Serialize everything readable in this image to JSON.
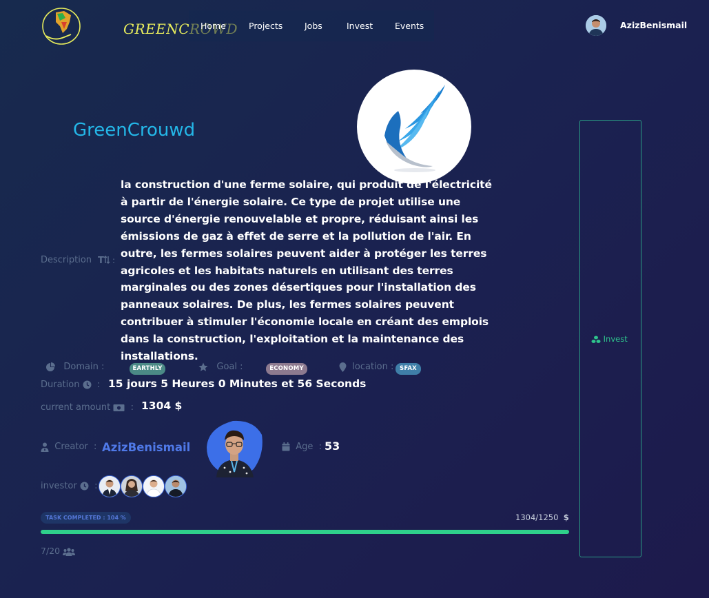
{
  "navbar": {
    "logo_text": "GREENCROWD",
    "links": [
      "Home",
      "Projects",
      "Jobs",
      "Invest",
      "Events"
    ],
    "user_name": "AzizBenismail"
  },
  "project": {
    "title": "GreenCrouwd",
    "description_label": "Description",
    "description": "la construction d'une ferme solaire, qui produit de l'électricité à partir de l'énergie solaire. Ce type de projet utilise une source d'énergie renouvelable et propre, réduisant ainsi les émissions de gaz à effet de serre et la pollution de l'air. En outre, les fermes solaires peuvent aider à protéger les terres agricoles et les habitats naturels en utilisant des terres marginales ou des zones désertiques pour l'installation des panneaux solaires. De plus, les fermes solaires peuvent contribuer à stimuler l'économie locale en créant des emplois dans la construction, l'exploitation et la maintenance des installations.",
    "domain_label": "Domain :",
    "domain_value": "EARTHLY",
    "goal_label": "Goal :",
    "goal_value": "ECONOMY",
    "location_label": "location :",
    "location_value": "SFAX",
    "duration_label": "Duration",
    "duration_value": "15 jours 5 Heures 0 Minutes et 56 Seconds",
    "amount_label": "current amount",
    "amount_value": "1304 $",
    "creator_label": "Creator",
    "creator_name": "AzizBenismail",
    "age_label": "Age",
    "age_value": "53",
    "investor_label": "investor",
    "investor_count": 4
  },
  "progress": {
    "task_label": "TASK COMPLETED : 104 %",
    "ratio_text": "1304/1250",
    "currency": "$",
    "fraction": 1.0,
    "members_text": "7/20"
  },
  "invest_panel": {
    "button_label": "Invest"
  },
  "colors": {
    "accent_blue": "#24b7e8",
    "progress_green": "#2fd08b",
    "creator_link": "#4f79e8",
    "badge_domain": "#4b8a86",
    "badge_goal": "#8d7a8f",
    "badge_location": "#3f7ea8"
  }
}
